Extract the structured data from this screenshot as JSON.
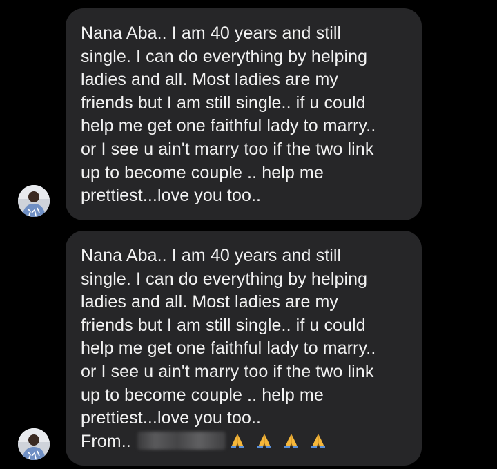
{
  "conversation": {
    "messages": [
      {
        "lines": [
          "Nana Aba.. I am 40 years and still",
          "single. I can do everything by helping",
          "ladies and all. Most ladies are my",
          "friends but I am still single.. if u could",
          "help me get one faithful lady to marry..",
          "or I see u ain't marry too if the two link",
          "up to become couple .. help me",
          "prettiest...love you too.."
        ]
      },
      {
        "lines": [
          "Nana Aba.. I am 40 years and still",
          "single. I can do everything by helping",
          "ladies and all. Most ladies are my",
          "friends but I am still single.. if u could",
          "help me get one faithful lady to marry..",
          "or I see u ain't marry too if the two link",
          "up to become couple .. help me",
          "prettiest...love you too.."
        ],
        "from_label": "From.. ",
        "sender_name_redacted": true,
        "emoji": [
          "folded-hands",
          "folded-hands",
          "folded-hands",
          "folded-hands"
        ]
      }
    ]
  },
  "colors": {
    "background": "#000000",
    "bubble": "#262628",
    "text": "#f2f2f2",
    "emoji": "#f5b73b"
  },
  "icons": {
    "avatar": "profile-photo",
    "emoji": "folded-hands"
  }
}
